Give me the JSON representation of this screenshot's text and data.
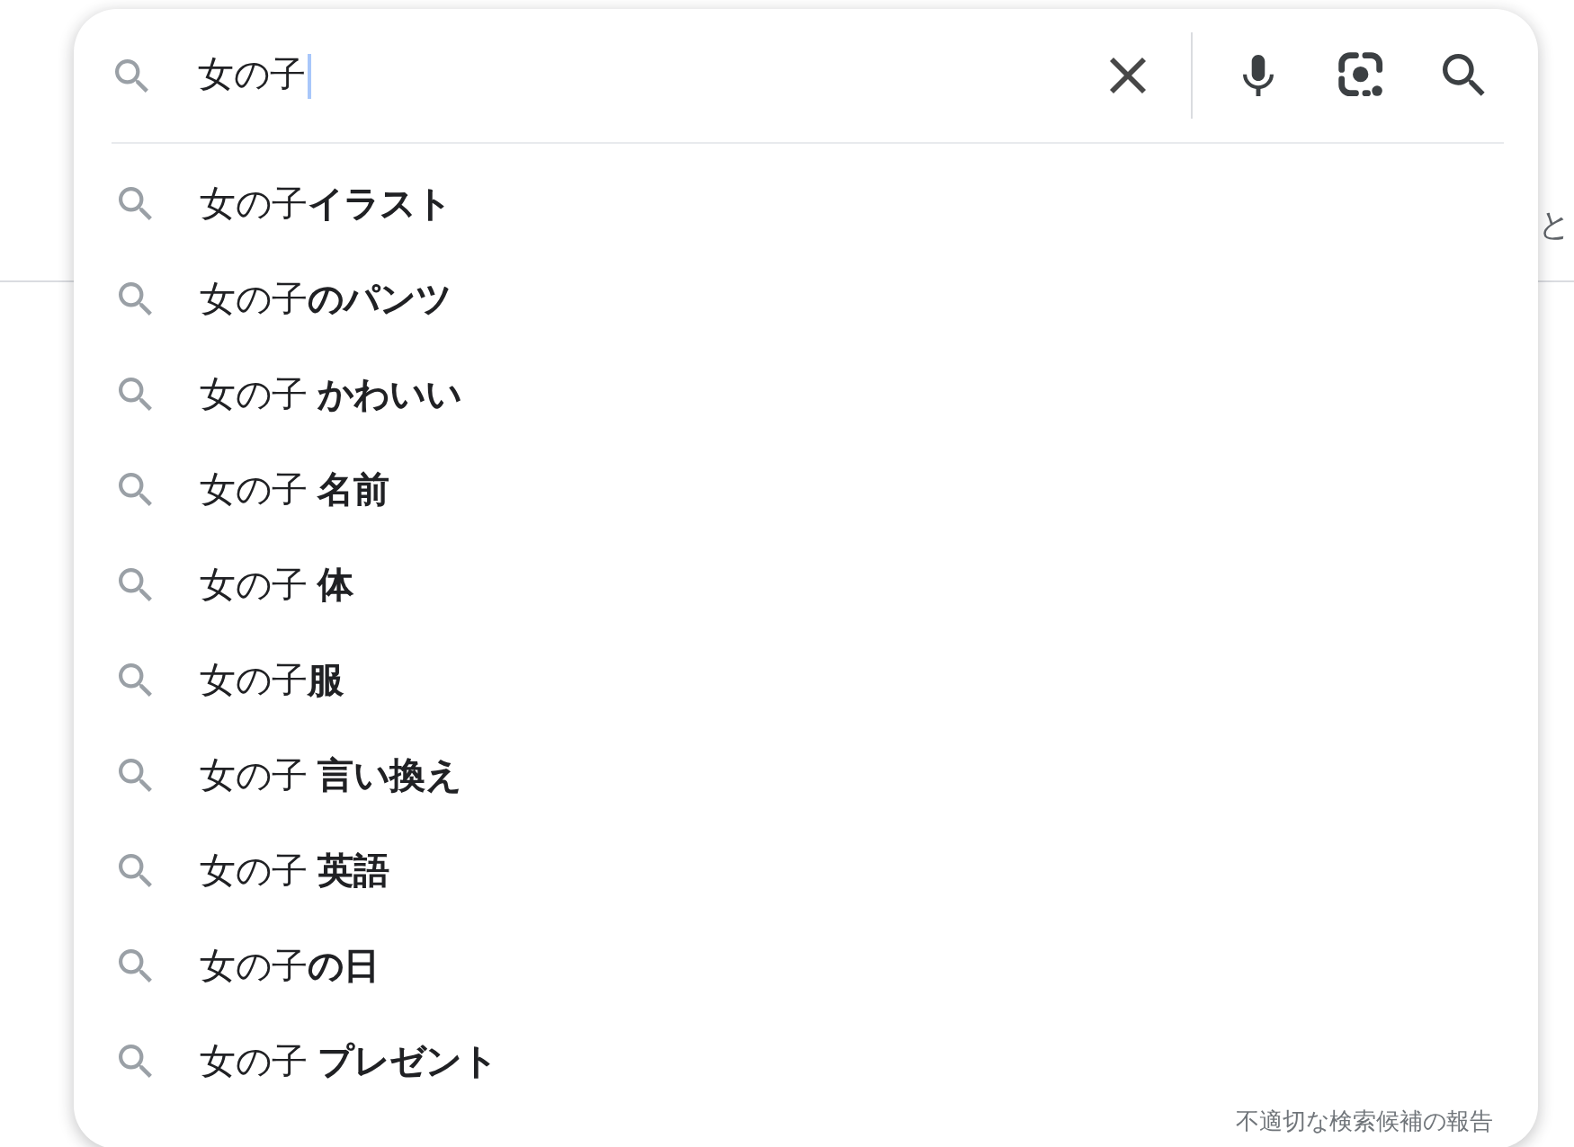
{
  "background": {
    "text_fragment": "と"
  },
  "search": {
    "value": "女の子",
    "focused": true
  },
  "suggestions": [
    "女の子**イラスト**",
    "女の子**のパンツ**",
    "女の子 **かわいい**",
    "女の子 **名前**",
    "女の子 **体**",
    "女の子**服**",
    "女の子 **言い換え**",
    "女の子 **英語**",
    "女の子**の日**",
    "女の子 **プレゼント**"
  ],
  "report_link": "不適切な検索候補の報告"
}
